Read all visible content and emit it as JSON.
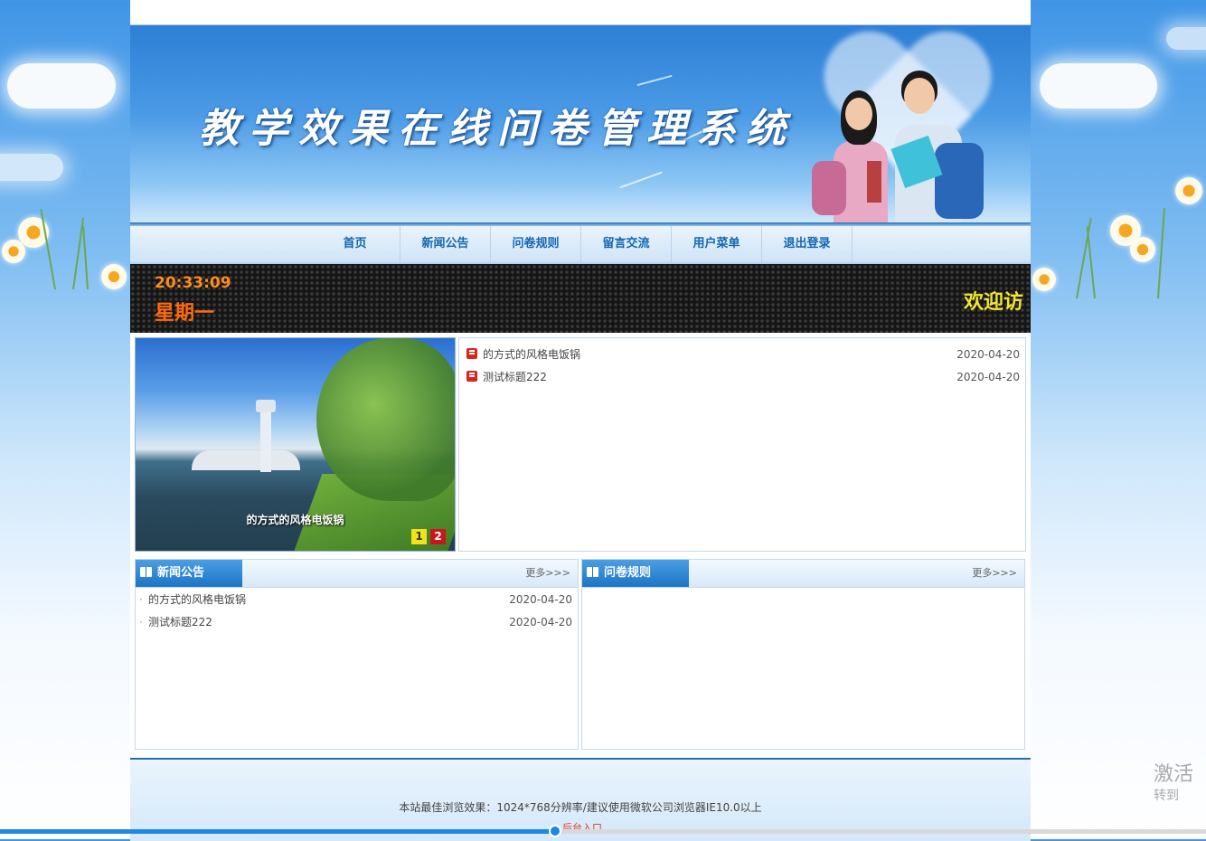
{
  "site": {
    "title": "教学效果在线问卷管理系统"
  },
  "nav": {
    "items": [
      "首页",
      "新闻公告",
      "问卷规则",
      "留言交流",
      "用户菜单",
      "退出登录"
    ]
  },
  "clock": {
    "time": "20:33:09",
    "weekday": "星期一",
    "welcome": "欢迎访"
  },
  "slideshow": {
    "caption": "的方式的风格电饭锅",
    "pages": [
      "1",
      "2"
    ],
    "active_page": 1
  },
  "headlines": [
    {
      "title": "的方式的风格电饭锅",
      "date": "2020-04-20"
    },
    {
      "title": "测试标题222",
      "date": "2020-04-20"
    }
  ],
  "news_panel": {
    "title": "新闻公告",
    "more": "更多>>>",
    "items": [
      {
        "title": "的方式的风格电饭锅",
        "date": "2020-04-20"
      },
      {
        "title": "测试标题222",
        "date": "2020-04-20"
      }
    ]
  },
  "rules_panel": {
    "title": "问卷规则",
    "more": "更多>>>",
    "items": []
  },
  "footer": {
    "copyright": "本站最佳浏览效果：1024*768分辨率/建议使用微软公司浏览器IE10.0以上",
    "admin_link": "后台入口"
  },
  "video_progress": 0.46,
  "watermark": {
    "line1": "激活",
    "line2": "转到"
  },
  "colors": {
    "primary": "#1c74c6",
    "nav_text": "#1565b0",
    "clock_time": "#ff8c1a",
    "clock_week": "#ff6a10",
    "welcome": "#f2e530",
    "icon_red": "#d9251d"
  }
}
